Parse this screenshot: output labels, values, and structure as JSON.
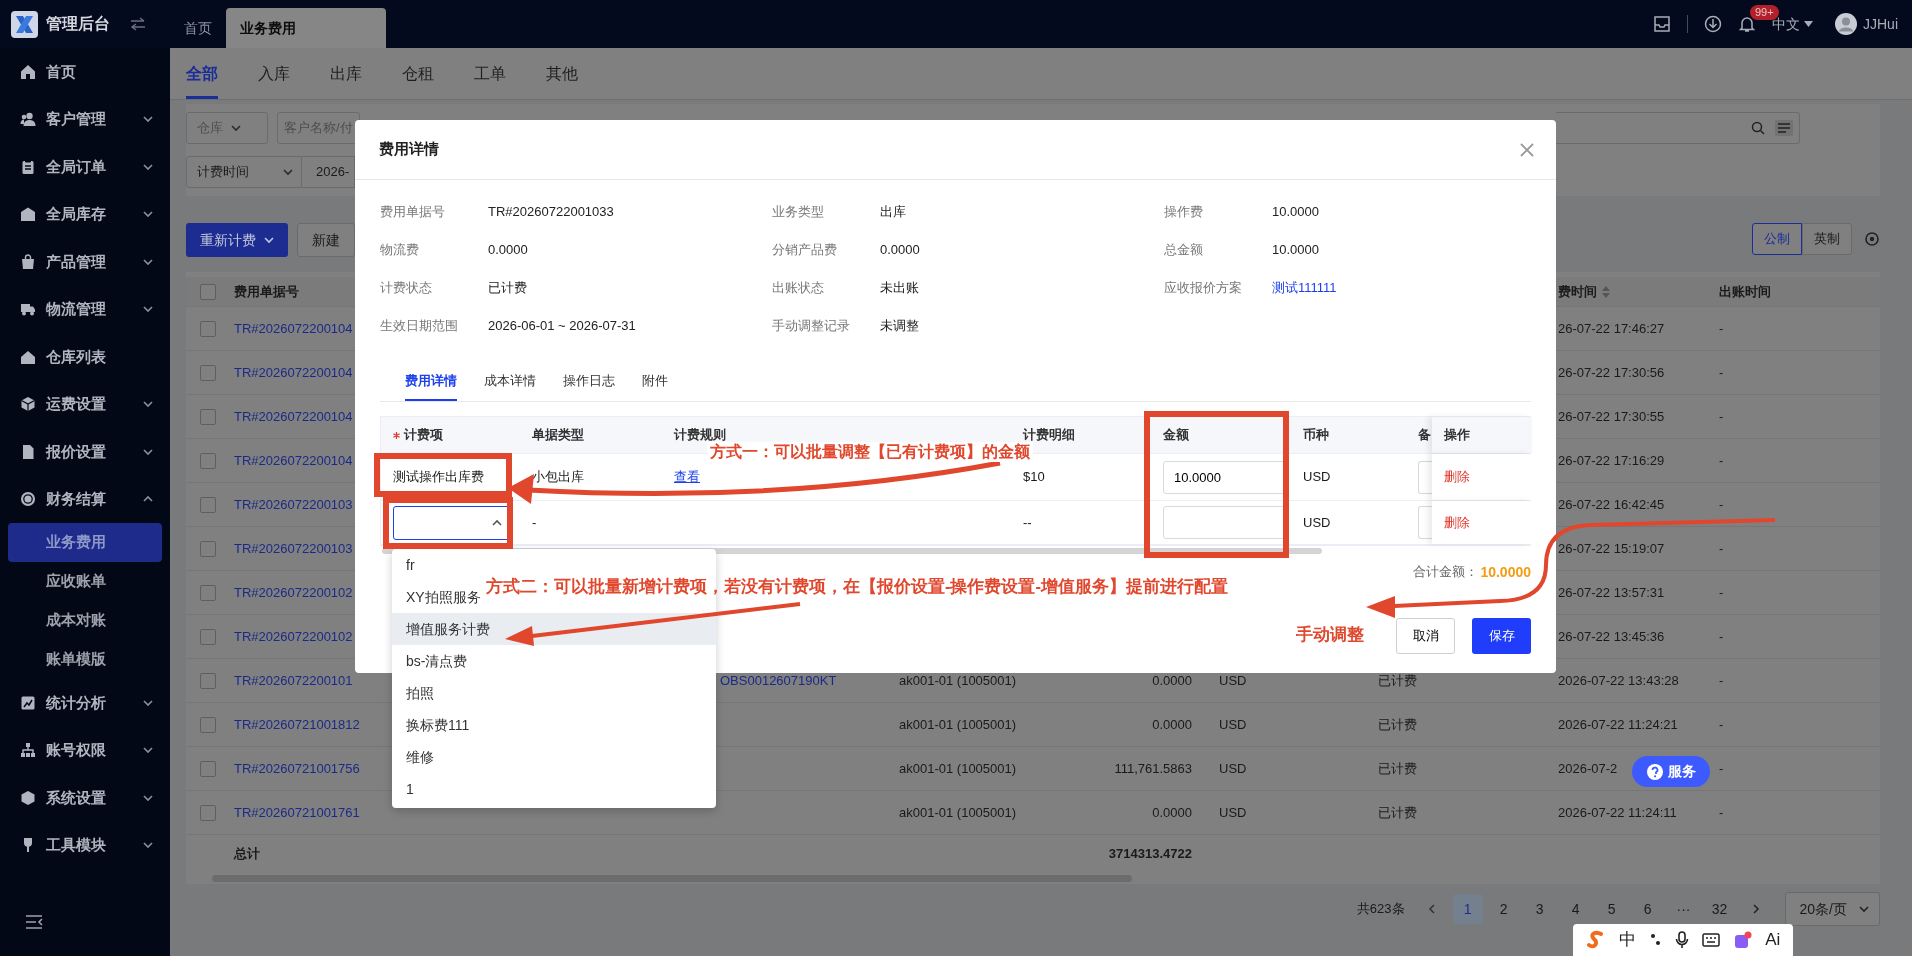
{
  "app": {
    "title": "管理后台"
  },
  "header_tabs": [
    {
      "label": "首页",
      "selected": false
    },
    {
      "label": "业务费用",
      "selected": true
    }
  ],
  "header": {
    "notification_badge": "99+",
    "language": "中文",
    "user": "JJHui"
  },
  "sidebar": {
    "items": [
      {
        "label": "首页",
        "selected": false
      },
      {
        "label": "客户管理",
        "selected": false,
        "expanded": false
      },
      {
        "label": "全局订单",
        "selected": false,
        "expanded": false
      },
      {
        "label": "全局库存",
        "selected": false,
        "expanded": false
      },
      {
        "label": "产品管理",
        "selected": false,
        "expanded": false
      },
      {
        "label": "物流管理",
        "selected": false,
        "expanded": false
      },
      {
        "label": "仓库列表",
        "selected": false
      },
      {
        "label": "运费设置",
        "selected": false,
        "expanded": false
      },
      {
        "label": "报价设置",
        "selected": false,
        "expanded": false
      },
      {
        "label": "财务结算",
        "selected": false,
        "expanded": true,
        "children": [
          {
            "label": "业务费用",
            "selected": true
          },
          {
            "label": "应收账单",
            "selected": false
          },
          {
            "label": "成本对账",
            "selected": false
          },
          {
            "label": "账单模版",
            "selected": false
          }
        ]
      },
      {
        "label": "统计分析",
        "selected": false,
        "expanded": false
      },
      {
        "label": "账号权限",
        "selected": false,
        "expanded": false
      },
      {
        "label": "系统设置",
        "selected": false,
        "expanded": false
      },
      {
        "label": "工具模块",
        "selected": false,
        "expanded": false
      }
    ]
  },
  "module_tabs": [
    {
      "label": "全部",
      "selected": true
    },
    {
      "label": "入库",
      "selected": false
    },
    {
      "label": "出库",
      "selected": false
    },
    {
      "label": "仓租",
      "selected": false
    },
    {
      "label": "工单",
      "selected": false
    },
    {
      "label": "其他",
      "selected": false
    }
  ],
  "filters": {
    "warehouse_placeholder": "仓库",
    "customer_placeholder": "客户名称/付",
    "time_type": "计费时间",
    "date_range": "2026-"
  },
  "toolbar": {
    "recalc_button": "重新计费",
    "new_button": "新建",
    "units": [
      {
        "label": "公制",
        "selected": true
      },
      {
        "label": "英制",
        "selected": false
      }
    ]
  },
  "table": {
    "all_checked": false,
    "columns": [
      "费用单据号",
      "费时间",
      "出账时间"
    ],
    "rows": [
      {
        "checked": false,
        "id": "TR#2026072200104",
        "billing_time": "26-07-22 17:46:27",
        "out_time": "-"
      },
      {
        "checked": false,
        "id": "TR#2026072200104",
        "billing_time": "26-07-22 17:30:56",
        "out_time": "-"
      },
      {
        "checked": false,
        "id": "TR#2026072200104",
        "billing_time": "26-07-22 17:30:55",
        "out_time": "-"
      },
      {
        "checked": false,
        "id": "TR#2026072200104",
        "billing_time": "26-07-22 17:16:29",
        "out_time": "-"
      },
      {
        "checked": false,
        "id": "TR#2026072200103",
        "billing_time": "26-07-22 16:42:45",
        "out_time": "-"
      },
      {
        "checked": false,
        "id": "TR#2026072200103",
        "billing_time": "26-07-22 15:19:07",
        "out_time": "-"
      },
      {
        "checked": false,
        "id": "TR#2026072200102",
        "billing_time": "26-07-22 13:57:31",
        "out_time": "-"
      },
      {
        "checked": false,
        "id": "TR#2026072200102",
        "billing_time": "26-07-22 13:45:36",
        "out_time": "-"
      },
      {
        "checked": false,
        "id": "TR#2026072200101",
        "order_no": "OBS0012607190KT",
        "customer": "ak001-01 (1005001)",
        "amount": "0.0000",
        "currency": "USD",
        "status": "已计费",
        "billing_time": "2026-07-22 13:43:28",
        "out_time": "-"
      },
      {
        "checked": false,
        "id": "TR#20260721001812",
        "customer": "ak001-01 (1005001)",
        "amount": "0.0000",
        "currency": "USD",
        "status": "已计费",
        "billing_time": "2026-07-22 11:24:21",
        "out_time": "-"
      },
      {
        "checked": false,
        "id": "TR#20260721001756",
        "customer": "ak001-01 (1005001)",
        "amount": "111,761.5863",
        "currency": "USD",
        "status": "已计费",
        "billing_time": "2026-07-2",
        "out_time": "-"
      },
      {
        "checked": false,
        "id": "TR#20260721001761",
        "customer": "ak001-01 (1005001)",
        "amount": "0.0000",
        "currency": "USD",
        "status": "已计费",
        "billing_time": "2026-07-22 11:24:11",
        "out_time": "-"
      }
    ],
    "total_label": "总计",
    "total_amount": "3714313.4722"
  },
  "pagination": {
    "total": "共623条",
    "pages": [
      {
        "label": "1",
        "selected": true
      },
      {
        "label": "2",
        "selected": false
      },
      {
        "label": "3",
        "selected": false
      },
      {
        "label": "4",
        "selected": false
      },
      {
        "label": "5",
        "selected": false
      },
      {
        "label": "6",
        "selected": false
      },
      {
        "label": "···",
        "selected": false
      },
      {
        "label": "32",
        "selected": false
      }
    ],
    "page_size": "20条/页"
  },
  "dialog": {
    "title": "费用详情",
    "fields": [
      {
        "label": "费用单据号",
        "value": "TR#20260722001033",
        "kind": "text"
      },
      {
        "label": "业务类型",
        "value": "出库",
        "kind": "text"
      },
      {
        "label": "操作费",
        "value": "10.0000",
        "kind": "text"
      },
      {
        "label": "物流费",
        "value": "0.0000",
        "kind": "text"
      },
      {
        "label": "分销产品费",
        "value": "0.0000",
        "kind": "text"
      },
      {
        "label": "总金额",
        "value": "10.0000",
        "kind": "text"
      },
      {
        "label": "计费状态",
        "value": "已计费",
        "kind": "text"
      },
      {
        "label": "出账状态",
        "value": "未出账",
        "kind": "text"
      },
      {
        "label": "应收报价方案",
        "value": "测试111111",
        "kind": "link"
      },
      {
        "label": "生效日期范围",
        "value": "2026-06-01 ~ 2026-07-31",
        "kind": "text"
      },
      {
        "label": "手动调整记录",
        "value": "未调整",
        "kind": "text"
      }
    ],
    "tabs": [
      {
        "label": "费用详情",
        "selected": true
      },
      {
        "label": "成本详情",
        "selected": false
      },
      {
        "label": "操作日志",
        "selected": false
      },
      {
        "label": "附件",
        "selected": false
      }
    ],
    "fee_table": {
      "columns": [
        {
          "label": "计费项",
          "required": true
        },
        {
          "label": "单据类型",
          "required": false
        },
        {
          "label": "计费规则",
          "required": false
        },
        {
          "label": "计费明细",
          "required": false
        },
        {
          "label": "金额",
          "required": false
        },
        {
          "label": "币种",
          "required": false
        },
        {
          "label": "备",
          "required": false
        },
        {
          "label": "操作",
          "required": false
        }
      ],
      "rows": [
        {
          "kind": "existing",
          "item": "测试操作出库费",
          "doc_type": "小包出库",
          "rule_link": "查看",
          "detail": "$10",
          "amount": "10.0000",
          "currency": "USD",
          "action": "删除"
        },
        {
          "kind": "new",
          "select_open": true,
          "doc_type": "-",
          "detail": "--",
          "currency": "USD",
          "action": "删除"
        }
      ]
    },
    "total_label": "合计金额：",
    "total_value": "10.0000",
    "cancel_button": "取消",
    "save_button": "保存",
    "dropdown": {
      "options": [
        {
          "label": "fr",
          "highlighted": false
        },
        {
          "label": "XY拍照服务",
          "highlighted": false
        },
        {
          "label": "增值服务计费",
          "highlighted": true
        },
        {
          "label": "bs-清点费",
          "highlighted": false
        },
        {
          "label": "拍照",
          "highlighted": false
        },
        {
          "label": "换标费111",
          "highlighted": false
        },
        {
          "label": "维修",
          "highlighted": false
        },
        {
          "label": "1",
          "highlighted": false
        }
      ]
    }
  },
  "annotations": [
    {
      "text": "方式一：可以批量调整【已有计费项】的金额"
    },
    {
      "text": "方式二：可以批量新增计费项，若没有计费项，在【报价设置-操作费设置-增值服务】提前进行配置"
    },
    {
      "text": "手动调整"
    }
  ],
  "service_button": "服务",
  "ime_bar": {
    "mode": "中",
    "ai": "Ai"
  }
}
